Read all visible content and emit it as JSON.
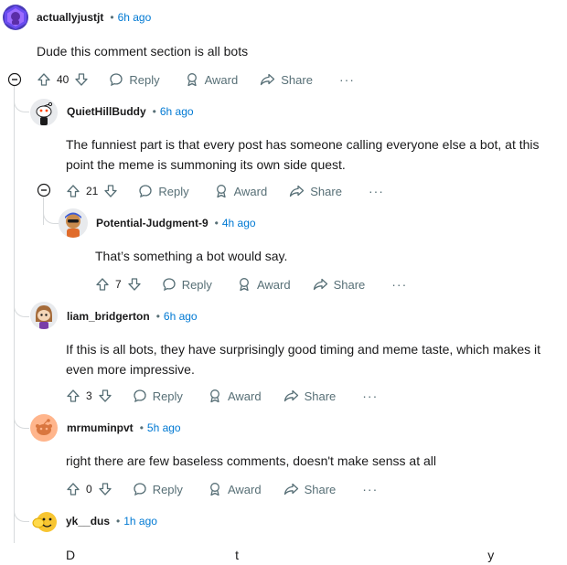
{
  "comments": [
    {
      "author": "actuallyjustjt",
      "time": "6h ago",
      "body": "Dude this comment section is all bots",
      "score": "40",
      "reply": "Reply",
      "award": "Award",
      "share": "Share",
      "more": "···"
    },
    {
      "author": "QuietHillBuddy",
      "time": "6h ago",
      "body_line1": "The funniest part is that every post has someone calling everyone else a bot, at this",
      "body_line2": "point the meme is summoning its own side quest.",
      "score": "21",
      "reply": "Reply",
      "award": "Award",
      "share": "Share",
      "more": "···"
    },
    {
      "author": "Potential-Judgment-9",
      "time": "4h ago",
      "body": "That’s something a bot would say.",
      "score": "7",
      "reply": "Reply",
      "award": "Award",
      "share": "Share",
      "more": "···"
    },
    {
      "author": "liam_bridgerton",
      "time": "6h ago",
      "body_line1": "If this is all bots, they have surprisingly good timing and meme taste, which makes it",
      "body_line2": "even more impressive.",
      "score": "3",
      "reply": "Reply",
      "award": "Award",
      "share": "Share",
      "more": "···"
    },
    {
      "author": "mrmuminpvt",
      "time": "5h ago",
      "body": "right there are few baseless comments, doesn't make senss at all",
      "score": "0",
      "reply": "Reply",
      "award": "Award",
      "share": "Share",
      "more": "···"
    },
    {
      "author": "yk__dus",
      "time": "1h ago",
      "body": "D                                             t                                                                      y"
    }
  ],
  "separator": "•",
  "colors": {
    "time_blue": "#0079d3",
    "meta_gray": "#576f76",
    "thread_line": "#d7dadc"
  }
}
